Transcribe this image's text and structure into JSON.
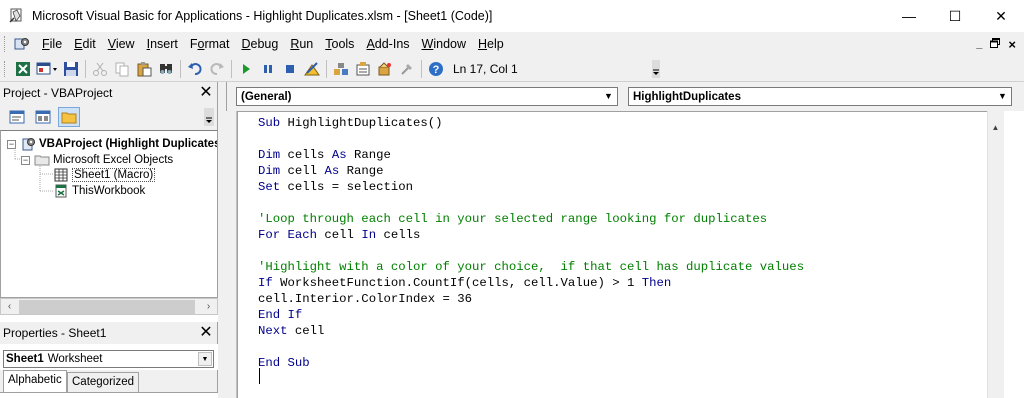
{
  "window": {
    "title": "Microsoft Visual Basic for Applications - Highlight Duplicates.xlsm - [Sheet1 (Code)]",
    "minimize": "—",
    "maximize": "☐",
    "close": "✕"
  },
  "menubar": {
    "items": [
      {
        "pre": "",
        "ul": "F",
        "post": "ile"
      },
      {
        "pre": "",
        "ul": "E",
        "post": "dit"
      },
      {
        "pre": "",
        "ul": "V",
        "post": "iew"
      },
      {
        "pre": "",
        "ul": "I",
        "post": "nsert"
      },
      {
        "pre": "F",
        "ul": "o",
        "post": "rmat"
      },
      {
        "pre": "",
        "ul": "D",
        "post": "ebug"
      },
      {
        "pre": "",
        "ul": "R",
        "post": "un"
      },
      {
        "pre": "",
        "ul": "T",
        "post": "ools"
      },
      {
        "pre": "",
        "ul": "A",
        "post": "dd-Ins"
      },
      {
        "pre": "",
        "ul": "W",
        "post": "indow"
      },
      {
        "pre": "",
        "ul": "H",
        "post": "elp"
      }
    ],
    "mdi_minimize": "_",
    "mdi_restore": "🗗",
    "mdi_close": "×"
  },
  "toolbar": {
    "position_label": "Ln 17, Col 1"
  },
  "project_panel": {
    "title": "Project - VBAProject",
    "tree": {
      "root": "VBAProject (Highlight Duplicates.xlsm)",
      "folder": "Microsoft Excel Objects",
      "items": [
        "Sheet1 (Macro)",
        "ThisWorkbook"
      ]
    }
  },
  "properties_panel": {
    "title": "Properties - Sheet1",
    "object_name": "Sheet1",
    "object_type": "Worksheet",
    "tabs": [
      "Alphabetic",
      "Categorized"
    ]
  },
  "code_window": {
    "object_combo": "(General)",
    "procedure_combo": "HighlightDuplicates",
    "lines": [
      [
        {
          "t": "Sub ",
          "c": "kw"
        },
        {
          "t": "HighlightDuplicates()",
          "c": "tx"
        }
      ],
      [],
      [
        {
          "t": "Dim ",
          "c": "kw"
        },
        {
          "t": "cells ",
          "c": "tx"
        },
        {
          "t": "As ",
          "c": "kw"
        },
        {
          "t": "Range",
          "c": "tx"
        }
      ],
      [
        {
          "t": "Dim ",
          "c": "kw"
        },
        {
          "t": "cell ",
          "c": "tx"
        },
        {
          "t": "As ",
          "c": "kw"
        },
        {
          "t": "Range",
          "c": "tx"
        }
      ],
      [
        {
          "t": "Set ",
          "c": "kw"
        },
        {
          "t": "cells = selection",
          "c": "tx"
        }
      ],
      [],
      [
        {
          "t": "'Loop through each cell in your selected range looking for duplicates",
          "c": "cm"
        }
      ],
      [
        {
          "t": "For Each ",
          "c": "kw"
        },
        {
          "t": "cell ",
          "c": "tx"
        },
        {
          "t": "In ",
          "c": "kw"
        },
        {
          "t": "cells",
          "c": "tx"
        }
      ],
      [],
      [
        {
          "t": "'Highlight with a color of your choice,  if that cell has duplicate values",
          "c": "cm"
        }
      ],
      [
        {
          "t": "If ",
          "c": "kw"
        },
        {
          "t": "WorksheetFunction.CountIf(cells, cell.Value) > 1 ",
          "c": "tx"
        },
        {
          "t": "Then",
          "c": "kw"
        }
      ],
      [
        {
          "t": "cell.Interior.ColorIndex = 36",
          "c": "tx"
        }
      ],
      [
        {
          "t": "End If",
          "c": "kw"
        }
      ],
      [
        {
          "t": "Next ",
          "c": "kw"
        },
        {
          "t": "cell",
          "c": "tx"
        }
      ],
      [],
      [
        {
          "t": "End Sub",
          "c": "kw"
        }
      ],
      []
    ]
  }
}
